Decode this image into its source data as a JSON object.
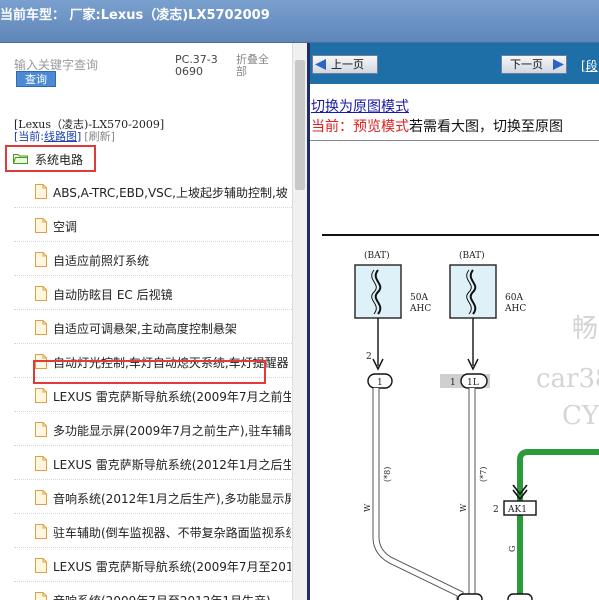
{
  "header": {
    "title": "当前车型：  厂家:Lexus（凌志)LX5702009"
  },
  "left_panel": {
    "search_placeholder": "输入关键字查询",
    "search_button": "查询",
    "pc_code": "PC.37-30690",
    "collapse_all": "折叠全部",
    "model": "[Lexus（凌志)-LX570-2009]",
    "current_label": "[当前:",
    "current_value": "线路图",
    "current_close": "]",
    "refresh": "[刷新]",
    "category": "系统电路",
    "items": [
      "ABS,A-TRC,EBD,VSC,上坡起步辅助控制,坡",
      "空调",
      "自适应前照灯系统",
      "自动防眩目 EC 后视镜",
      "自适应可调悬架,主动高度控制悬架",
      "自动灯光控制,车灯自动熄灭系统,车灯提醒器",
      "LEXUS 雷克萨斯导航系统(2009年7月之前生产",
      "多功能显示屏(2009年7月之前生产),驻车辅助",
      "LEXUS 雷克萨斯导航系统(2012年1月之后生产",
      "音响系统(2012年1月之后生产),多功能显示屏",
      "驻车辅助(倒车监视器、不带复杂路面监视系统",
      "LEXUS 雷克萨斯导航系统(2009年7月至2012年",
      "音响系统(2009年7月至2012年1月生产),"
    ],
    "highlighted_item": "自适应可调悬架,主动高度控制悬架"
  },
  "right_panel": {
    "prev_button": "上一页",
    "next_button": "下一页",
    "nav_more": "[段",
    "switch_link": "切换为原图模式",
    "preview_prefix": "当前：预览模式",
    "preview_suffix": "若需看大图，切换至原图",
    "diagram": {
      "fuse1_top": "(BAT)",
      "fuse1_rating": "50A",
      "fuse1_name": "AHC",
      "fuse2_top": "(BAT)",
      "fuse2_rating": "60A",
      "fuse2_name": "AHC",
      "pin1": "2",
      "conn1": "1",
      "pin2": "1",
      "conn2": "1L",
      "wire1": "(*8)",
      "wire2": "(*7)",
      "wire1_color": "W",
      "wire2_color": "W",
      "pin3": "2",
      "conn3": "AK1",
      "wire3_color": "G",
      "watermark1": "畅",
      "watermark2": "car38",
      "watermark3": "CY"
    }
  },
  "colors": {
    "header_bg": "#6a91c3",
    "nav_bg": "#1e6fa8",
    "highlight_border": "#e03a3a",
    "green_wire": "#2a9a3a",
    "link": "#1a1aa8"
  }
}
